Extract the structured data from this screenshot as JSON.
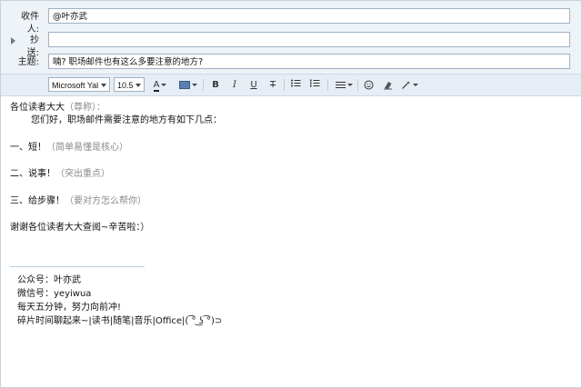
{
  "fields": {
    "to_label": "收件人:",
    "to_value": "@叶亦武",
    "cc_label": "抄送:",
    "cc_value": "",
    "subject_label": "主题:",
    "subject_value": "喃? 职场邮件也有这么多要注意的地方?"
  },
  "toolbar": {
    "font": "Microsoft Yal",
    "size": "10.5",
    "font_color_glyph": "A",
    "bold": "B",
    "italic": "I",
    "underline": "U",
    "strikethrough": "T"
  },
  "body": {
    "greeting": "各位读者大大",
    "greeting_note": "（尊称）：",
    "intro": "您们好，职场邮件需要注意的地方有如下几点：",
    "point1": "一、短！",
    "point1_note": "（简单易懂是核心）",
    "point2": "二、说事！",
    "point2_note": "（突出重点）",
    "point3": "三、给步骤！",
    "point3_note": "（要对方怎么帮你）",
    "thanks": "谢谢各位读者大大查阅~辛苦啦：）"
  },
  "signature": {
    "line1": "公众号：叶亦武",
    "line2": "微信号：yeyiwua",
    "line3": "每天五分钟，努力向前冲!",
    "line4": "碎片时间聊起来~|读书|随笔|音乐|Office|( ͡° ͜ʖ ͡°)⊃"
  }
}
